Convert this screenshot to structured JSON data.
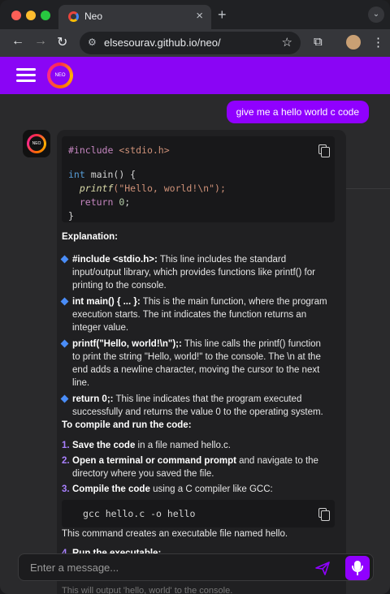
{
  "browser": {
    "tab_title": "Neo",
    "url": "elsesourav.github.io/neo/"
  },
  "app": {
    "logo_text": "NEO"
  },
  "chat": {
    "user_message": "give me a hello world c code",
    "code1": {
      "l1_kw": "#include",
      "l1_str": "<stdio.h>",
      "l2_kw": "int",
      "l2_rest": "main() {",
      "l3_fn": "printf",
      "l3_str": "(\"Hello, world!\\n\");",
      "l4_kw": "return",
      "l4_num": "0",
      "l4_end": ";",
      "l5": "}"
    },
    "explanation_heading": "Explanation:",
    "bullets": [
      {
        "title": "#include <stdio.h>:",
        "text": "This line includes the standard input/output library, which provides functions like printf() for printing to the console."
      },
      {
        "title": "int main() { ... }:",
        "text": "This is the main function, where the program execution starts. The int indicates the function returns an integer value."
      },
      {
        "title": "printf(\"Hello, world!\\n\");:",
        "text": "This line calls the printf() function to print the string \"Hello, world!\" to the console. The \\n at the end adds a newline character, moving the cursor to the next line."
      },
      {
        "title": "return 0;:",
        "text": "This line indicates that the program executed successfully and returns the value 0 to the operating system."
      }
    ],
    "compile_heading": "To compile and run the code:",
    "steps": [
      {
        "num": "1.",
        "title": "Save the code",
        "text": "in a file named hello.c."
      },
      {
        "num": "2.",
        "title": "Open a terminal or command prompt",
        "text": "and navigate to the directory where you saved the file."
      },
      {
        "num": "3.",
        "title": "Compile the code",
        "text": "using a C compiler like GCC:"
      },
      {
        "num": "4.",
        "title": "Run the executable:",
        "text": ""
      }
    ],
    "code2": "gcc hello.c -o hello",
    "after_code2": "This command creates an executable file named hello.",
    "ghost_text": "This will output 'hello, world' to the console."
  },
  "input": {
    "placeholder": "Enter a message..."
  },
  "colors": {
    "accent": "#8a05f5",
    "user_bubble": "#9000ff",
    "bullet": "#4a8df8"
  }
}
